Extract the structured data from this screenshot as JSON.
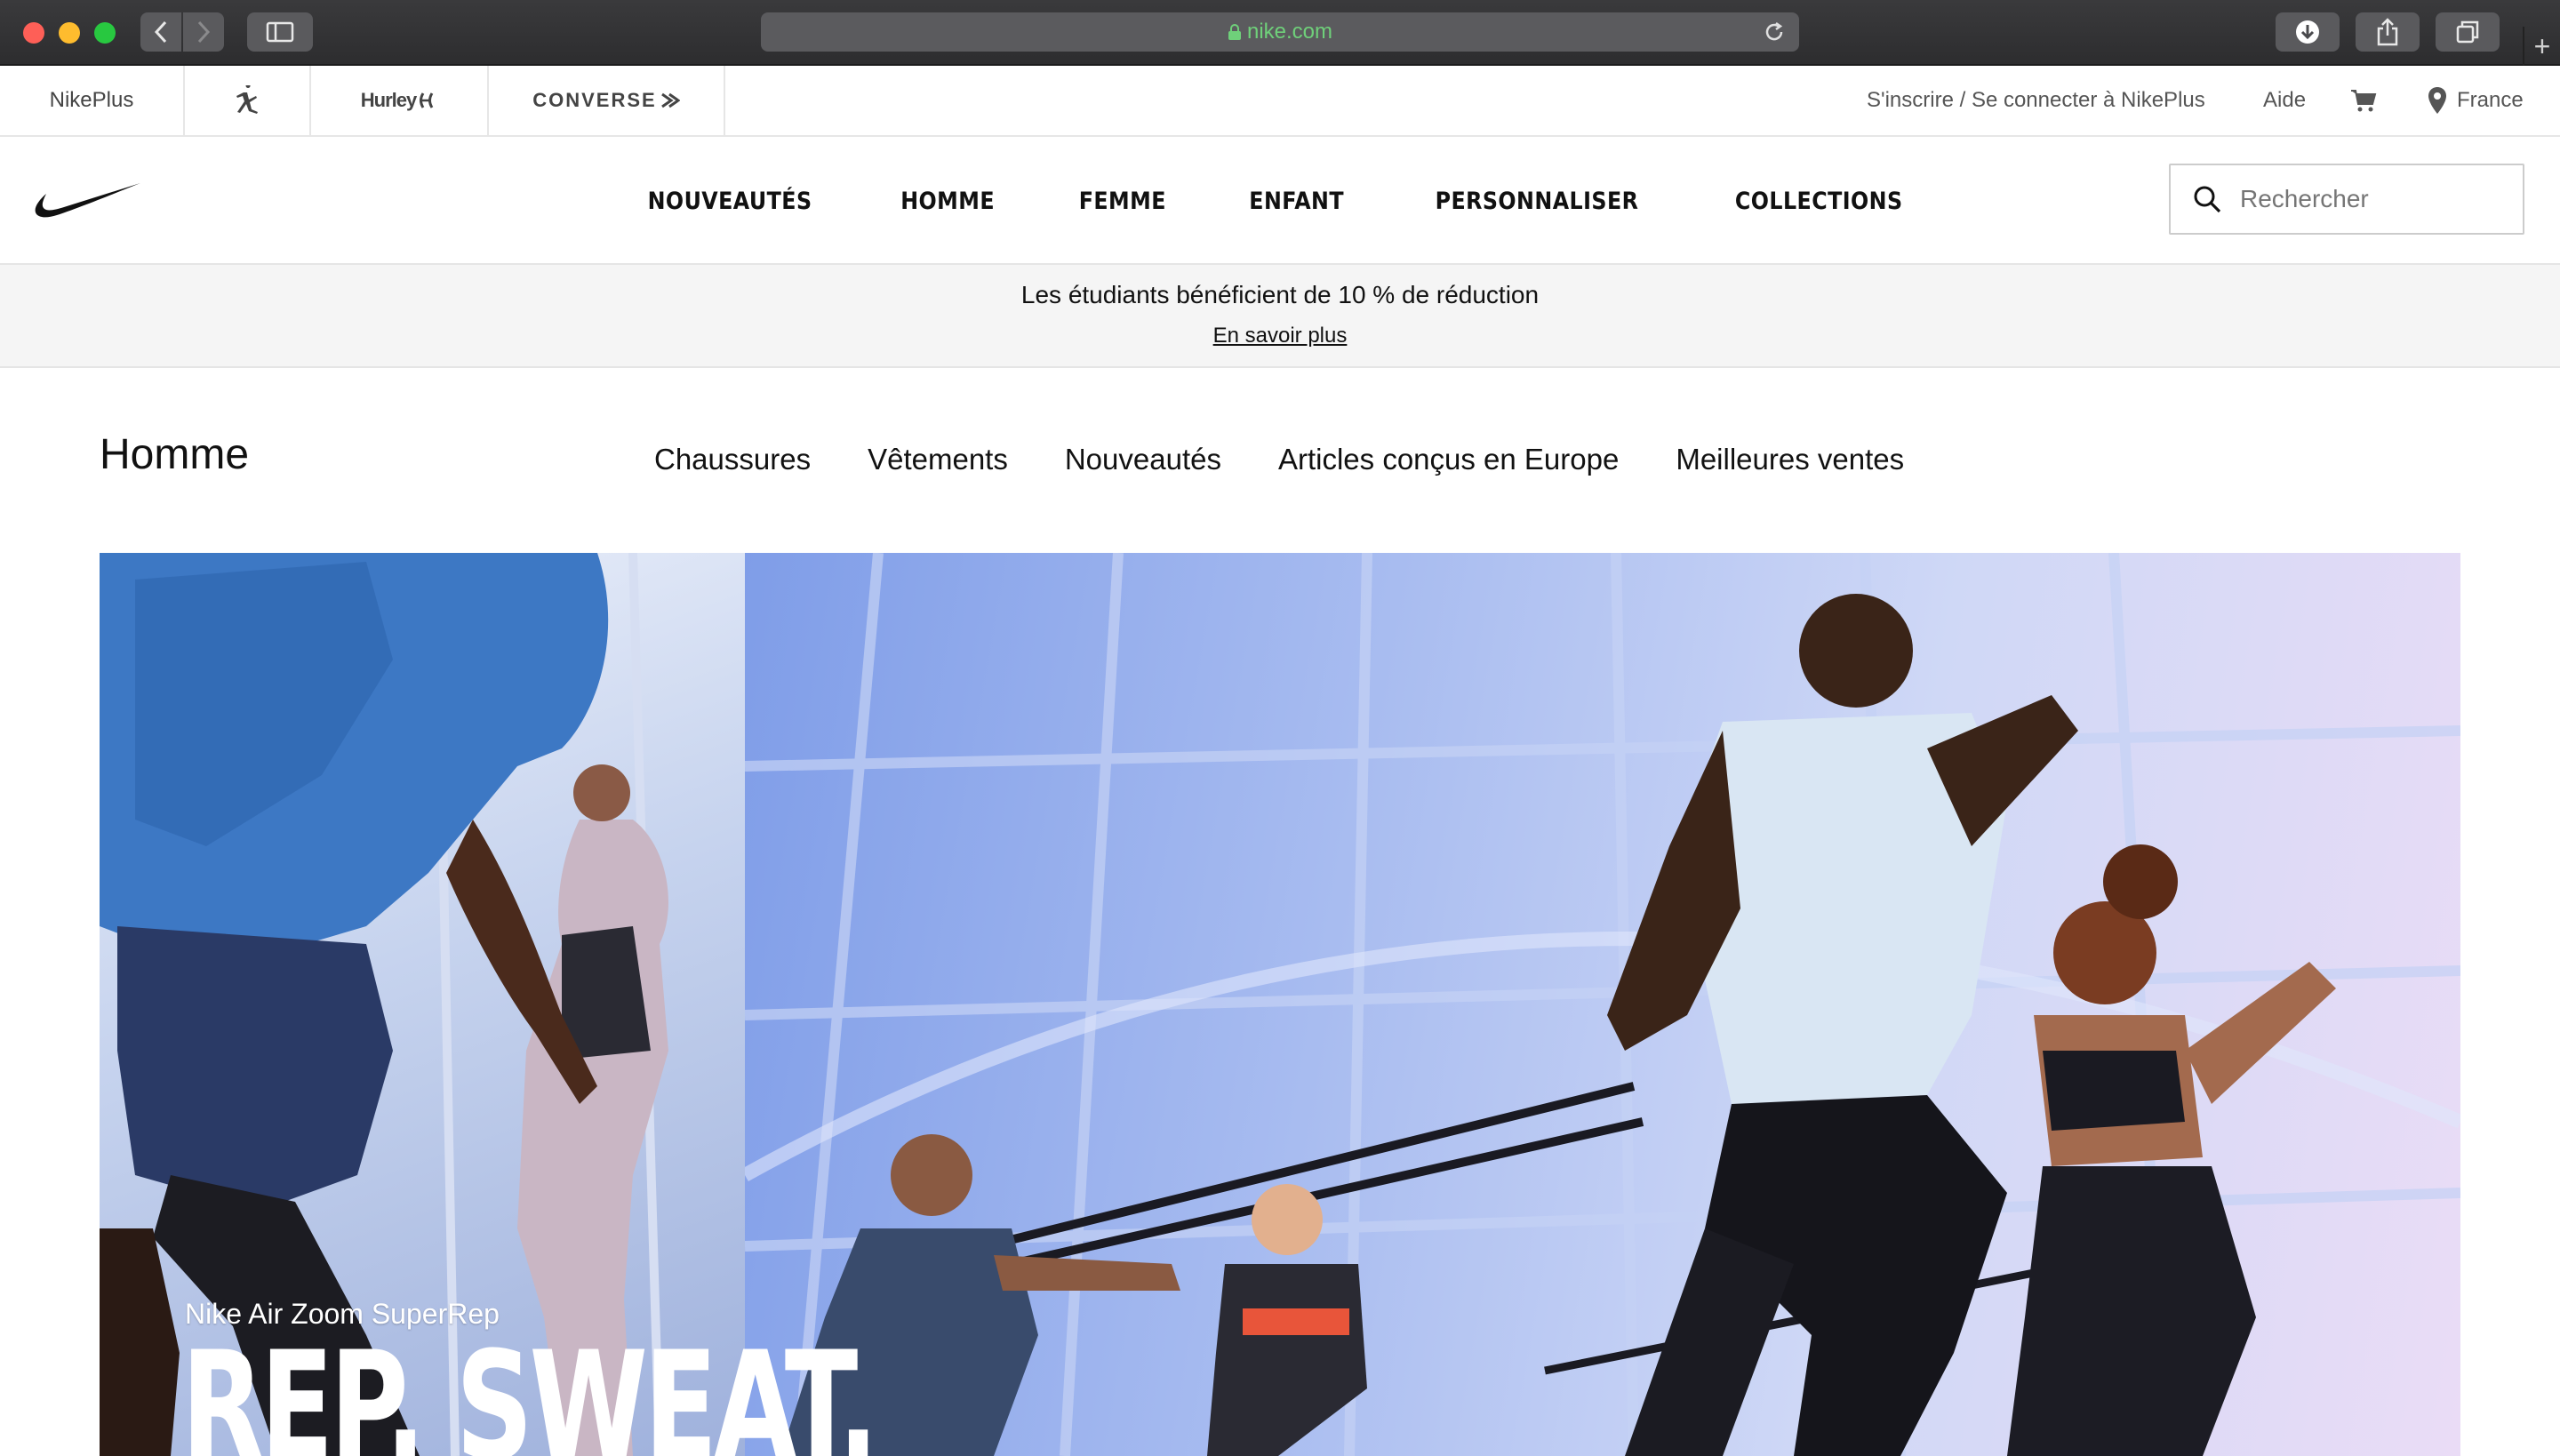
{
  "browser": {
    "url": "nike.com",
    "colors": {
      "chrome": "#2d2d2f",
      "url_text": "#6fd07a"
    }
  },
  "utility_bar": {
    "brands": {
      "nikeplus": "NikePlus",
      "hurley": "Hurley",
      "converse": "CONVERSE"
    },
    "signin": "S'inscrire / Se connecter à NikePlus",
    "help": "Aide",
    "country": "France"
  },
  "nav": {
    "items": [
      "NOUVEAUTÉS",
      "HOMME",
      "FEMME",
      "ENFANT",
      "PERSONNALISER",
      "COLLECTIONS"
    ],
    "search_placeholder": "Rechercher"
  },
  "promo": {
    "message": "Les étudiants bénéficient de 10 % de réduction",
    "link": "En savoir plus"
  },
  "category": {
    "title": "Homme",
    "subnav": [
      "Chaussures",
      "Vêtements",
      "Nouveautés",
      "Articles conçus en Europe",
      "Meilleures ventes"
    ]
  },
  "hero": {
    "caption": "Nike Air Zoom SuperRep",
    "headline": "REP. SWEAT."
  }
}
